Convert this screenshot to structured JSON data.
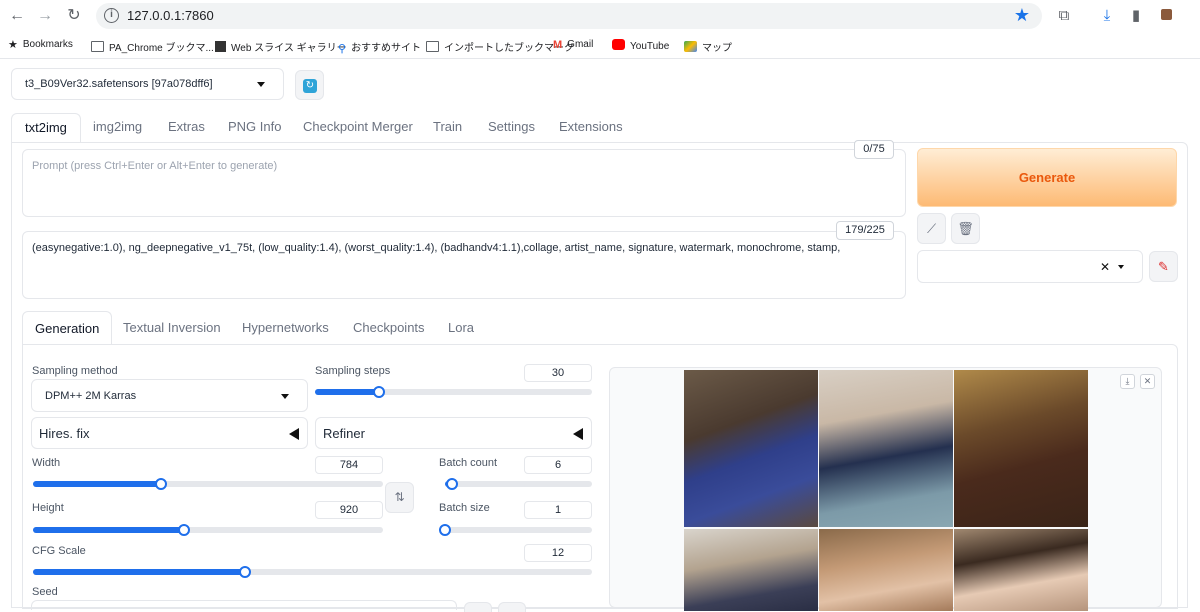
{
  "browser": {
    "url": "127.0.0.1:7860",
    "bookmarks": [
      {
        "label": "Bookmarks",
        "icon": "star-icon"
      },
      {
        "label": "PA_Chrome ブックマ...",
        "icon": "folder-icon"
      },
      {
        "label": "Web スライス ギャラリー",
        "icon": "web-slice-icon"
      },
      {
        "label": "おすすめサイト",
        "icon": "search-icon"
      },
      {
        "label": "インポートしたブックマーク",
        "icon": "folder-icon"
      },
      {
        "label": "Gmail",
        "icon": "gmail-icon"
      },
      {
        "label": "YouTube",
        "icon": "youtube-icon"
      },
      {
        "label": "マップ",
        "icon": "maps-icon"
      }
    ]
  },
  "checkpoint": {
    "value": "t3_B09Ver32.safetensors [97a078dff6]"
  },
  "tabs": [
    "txt2img",
    "img2img",
    "Extras",
    "PNG Info",
    "Checkpoint Merger",
    "Train",
    "Settings",
    "Extensions"
  ],
  "prompt": {
    "placeholder": "Prompt (press Ctrl+Enter or Alt+Enter to generate)",
    "counter": "0/75"
  },
  "negative_prompt": {
    "value": "(easynegative:1.0), ng_deepnegative_v1_75t, (low_quality:1.4), (worst_quality:1.4), (badhandv4:1.1),collage, artist_name, signature, watermark, monochrome, stamp,",
    "counter": "179/225"
  },
  "generate_label": "Generate",
  "colors": {
    "generate": "#ea580c",
    "slider": "#1f6feb"
  },
  "sub_tabs": [
    "Generation",
    "Textual Inversion",
    "Hypernetworks",
    "Checkpoints",
    "Lora"
  ],
  "generation": {
    "sampling_method_label": "Sampling method",
    "sampling_method": "DPM++ 2M Karras",
    "sampling_steps_label": "Sampling steps",
    "sampling_steps": "30",
    "sampling_steps_fraction": 0.23,
    "hires_fix": "Hires. fix",
    "refiner": "Refiner",
    "width_label": "Width",
    "width": "784",
    "width_fraction": 0.365,
    "height_label": "Height",
    "height": "920",
    "height_fraction": 0.43,
    "batch_count_label": "Batch count",
    "batch_count": "6",
    "batch_count_fraction": 0.05,
    "batch_size_label": "Batch size",
    "batch_size": "1",
    "batch_size_fraction": 0.0,
    "cfg_label": "CFG Scale",
    "cfg": "12",
    "cfg_fraction": 0.38,
    "seed_label": "Seed"
  }
}
